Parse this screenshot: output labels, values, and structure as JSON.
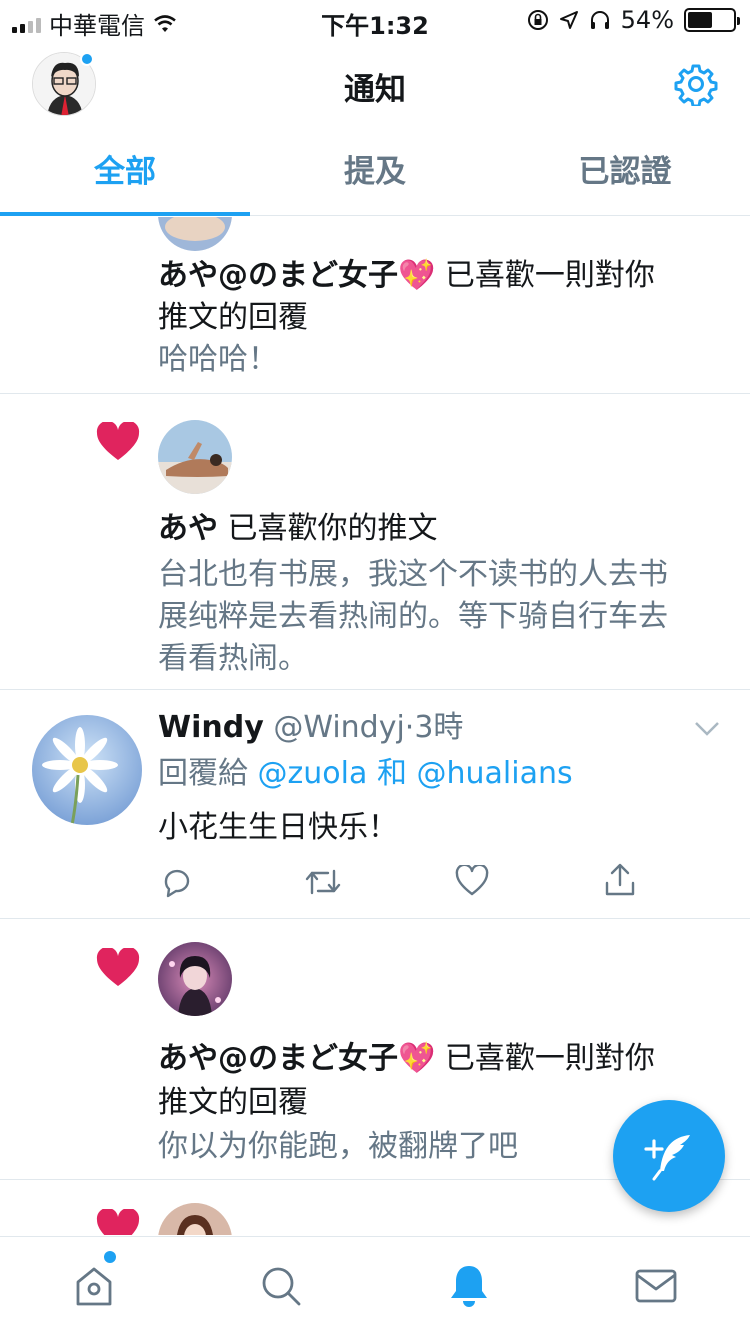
{
  "status_bar": {
    "carrier": "中華電信",
    "time": "下午1:32",
    "battery": "54%"
  },
  "header": {
    "title": "通知",
    "icons": [
      "avatar",
      "gear-icon"
    ]
  },
  "tabs": [
    {
      "label": "全部",
      "active": true
    },
    {
      "label": "提及",
      "active": false
    },
    {
      "label": "已認證",
      "active": false
    }
  ],
  "notifications": [
    {
      "user": "あや@のまど女子",
      "emoji": "💖",
      "action": "已喜歡一則對你",
      "action2": "推文的回覆",
      "text": "哈哈哈！"
    },
    {
      "user": "あや",
      "action": "已喜歡你的推文",
      "text_lines": [
        "台北也有书展，我这个不读书的人去书",
        "展纯粹是去看热闹的。等下骑自行车去",
        "看看热闹。"
      ]
    },
    {
      "name": "Windy",
      "handle": "@Windyj",
      "sep": "·",
      "time": "3時",
      "reply_prefix": "回覆給",
      "reply_to_1": "@zuola",
      "reply_and": "和",
      "reply_to_2": "@hualians",
      "text": "小花生生日快乐！",
      "actions": [
        "reply-icon",
        "retweet-icon",
        "like-icon",
        "share-icon"
      ]
    },
    {
      "user": "あや@のまど女子",
      "emoji": "💖",
      "action": "已喜歡一則對你",
      "action2": "推文的回覆",
      "text": "你以为你能跑，被翻牌了吧"
    }
  ],
  "bottom_nav": [
    "home-icon",
    "search-icon",
    "notifications-icon",
    "messages-icon"
  ],
  "colors": {
    "accent": "#1da1f2",
    "heart": "#e0245e",
    "secondary_text": "#657786"
  }
}
